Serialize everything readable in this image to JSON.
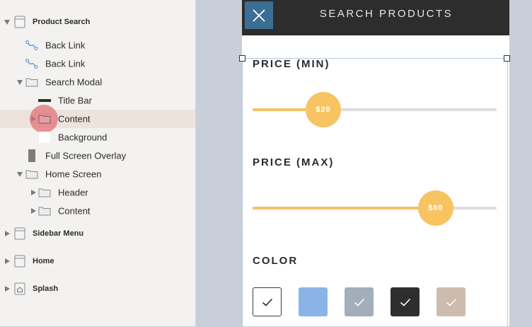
{
  "layers": {
    "product_search": "Product Search",
    "back_link_1": "Back Link",
    "back_link_2": "Back Link",
    "search_modal": "Search Modal",
    "title_bar": "Title Bar",
    "content": "Content",
    "background": "Background",
    "full_screen_overlay": "Full Screen Overlay",
    "home_screen": "Home Screen",
    "header": "Header",
    "home_content": "Content",
    "sidebar_menu": "Sidebar Menu",
    "home": "Home",
    "splash": "Splash"
  },
  "phone": {
    "title": "SEARCH PRODUCTS",
    "price_min": {
      "label": "PRICE (MIN)",
      "value_label": "$20",
      "fraction": 0.29
    },
    "price_max": {
      "label": "PRICE (MAX)",
      "value_label": "$80",
      "fraction": 0.75
    },
    "color": {
      "label": "COLOR",
      "swatches": [
        {
          "name": "white",
          "color": "#ffffff",
          "checked": true
        },
        {
          "name": "blue",
          "color": "#8ab4e8",
          "checked": false
        },
        {
          "name": "gray",
          "color": "#a3aebb",
          "checked": true
        },
        {
          "name": "black",
          "color": "#2e2e2e",
          "checked": true
        },
        {
          "name": "beige",
          "color": "#cdbcad",
          "checked": true
        }
      ]
    }
  },
  "colors": {
    "accent": "#f7c461",
    "titlebar": "#2d2d2d",
    "close_button": "#3a6f93",
    "selection": "#e06a74"
  }
}
